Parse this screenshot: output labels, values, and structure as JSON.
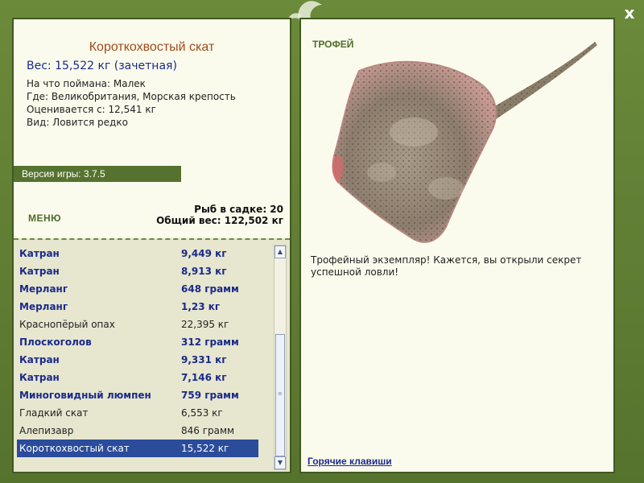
{
  "window": {
    "close_label": "x"
  },
  "fish": {
    "title": "Короткохвостый скат",
    "weight": "Вес: 15,522 кг (зачетная)",
    "info": [
      "На что поймана: Малек",
      "Где: Великобритания, Морская крепость",
      "Оценивается с: 12,541 кг",
      "Вид: Ловится редко"
    ]
  },
  "version": "Версия игры: 3.7.5",
  "menu_label": "МЕНЮ",
  "keep": {
    "count": "Рыб в садке: 20",
    "total_weight": "Общий вес: 122,502 кг"
  },
  "catch_list": [
    {
      "name": "Катран",
      "weight": "9,449 кг",
      "style": "bold"
    },
    {
      "name": "Катран",
      "weight": "8,913 кг",
      "style": "bold"
    },
    {
      "name": "Мерланг",
      "weight": "648 грамм",
      "style": "bold"
    },
    {
      "name": "Мерланг",
      "weight": "1,23 кг",
      "style": "bold"
    },
    {
      "name": "Краснопёрый опах",
      "weight": "22,395 кг",
      "style": "normal"
    },
    {
      "name": "Плоскоголов",
      "weight": "312 грамм",
      "style": "bold"
    },
    {
      "name": "Катран",
      "weight": "9,331 кг",
      "style": "bold"
    },
    {
      "name": "Катран",
      "weight": "7,146 кг",
      "style": "bold"
    },
    {
      "name": "Миноговидный люмпен",
      "weight": "759 грамм",
      "style": "bold"
    },
    {
      "name": "Гладкий скат",
      "weight": "6,553 кг",
      "style": "normal"
    },
    {
      "name": "Алепизавр",
      "weight": "846 грамм",
      "style": "normal"
    },
    {
      "name": "Короткохвостый скат",
      "weight": "15,522 кг",
      "style": "selected"
    }
  ],
  "trophy": {
    "label": "ТРОФЕЙ",
    "text": "Трофейный экземпляр! Кажется, вы открыли секрет успешной ловли!"
  },
  "hotkeys_label": "Горячие клавиши",
  "colors": {
    "frame": "#5d7a33",
    "title": "#a14a1a",
    "link_blue": "#1a2a8a",
    "selected_row": "#2b4c9a"
  }
}
